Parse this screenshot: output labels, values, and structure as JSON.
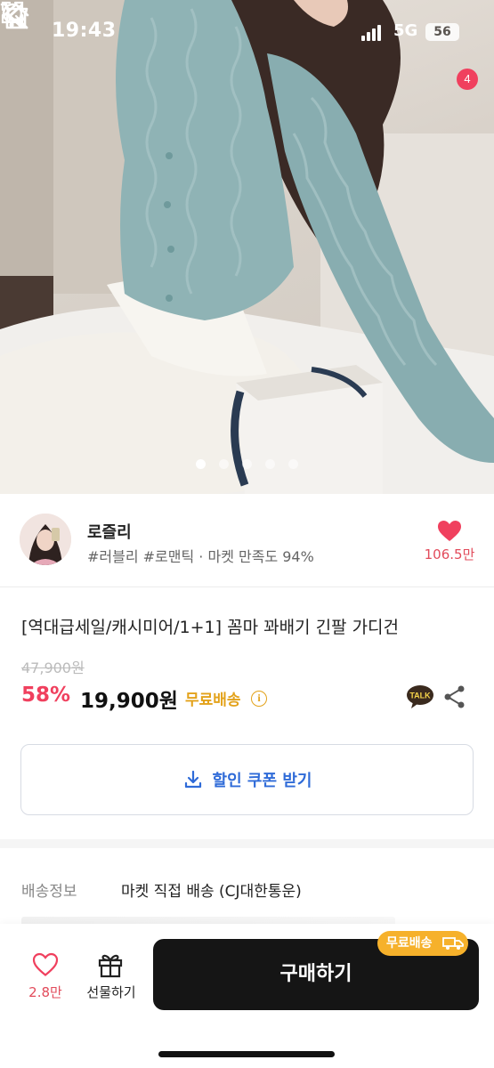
{
  "status_bar": {
    "time": "19:43",
    "network": "5G",
    "battery": "56"
  },
  "nav": {
    "cart_count": "4",
    "icons": [
      "back-icon",
      "home-icon",
      "search-icon",
      "cart-icon"
    ]
  },
  "carousel": {
    "total_slides": 5,
    "active_slide": 1
  },
  "seller": {
    "name": "로즐리",
    "tags": "#러블리 #로맨틱 · 마켓 만족도 94%",
    "likes": "106.5만"
  },
  "product": {
    "title": "[역대급세일/캐시미어/1+1] 꼼마 꽈배기 긴팔 가디건",
    "original_price": "47,900원",
    "discount": "58%",
    "price": "19,900원",
    "shipping_badge": "무료배송",
    "info_mark": "i",
    "talk_label": "TALK"
  },
  "coupon": {
    "label": "할인 쿠폰 받기"
  },
  "shipping": {
    "label": "배송정보",
    "value": "마켓 직접 배송 (CJ대한통운)"
  },
  "bottom_bar": {
    "wish_count": "2.8만",
    "gift_label": "선물하기",
    "buy_label": "구매하기",
    "free_badge": "무료배송"
  },
  "colors": {
    "accent_pink": "#f0405e",
    "free_ship_yellow": "#e3a21a",
    "coupon_blue": "#2f6bd8",
    "buy_button": "#151515",
    "sweater": "#8fb3b5"
  }
}
